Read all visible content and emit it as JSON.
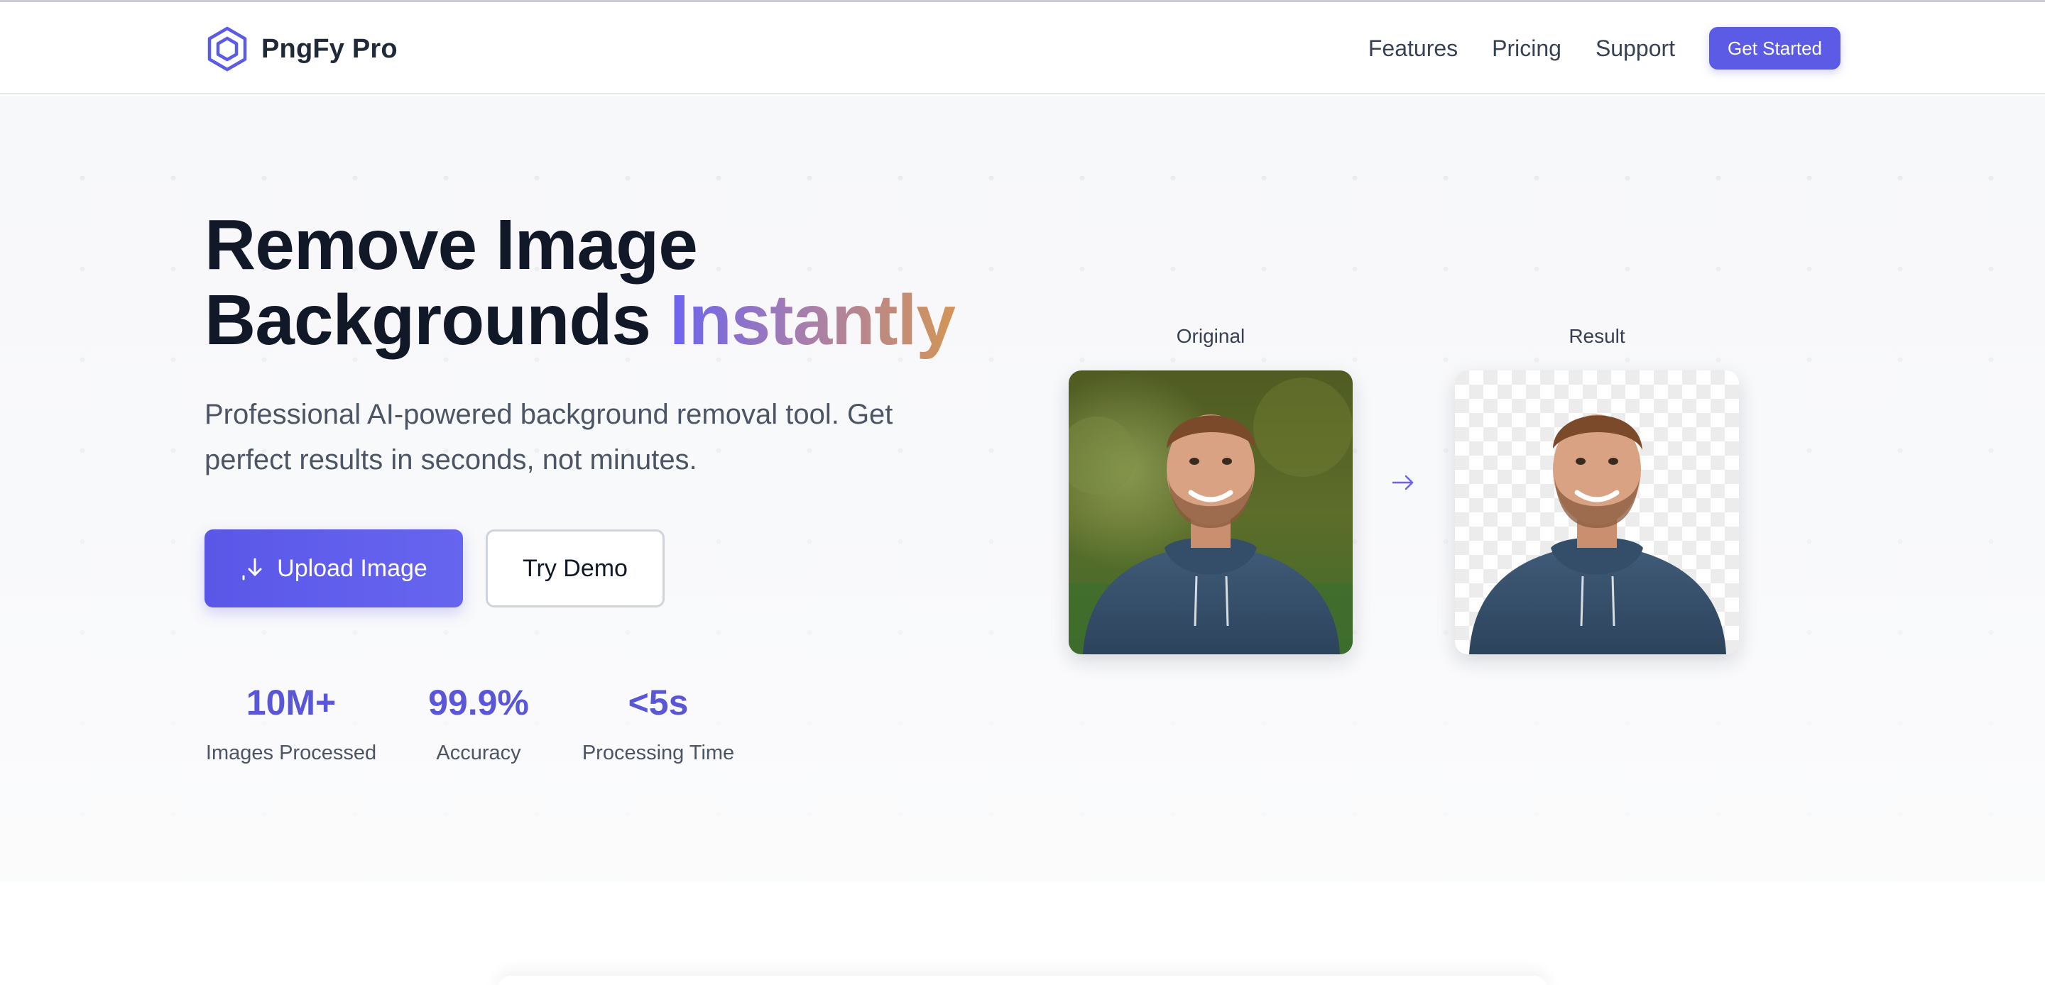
{
  "nav": {
    "brand": "PngFy Pro",
    "links": [
      "Features",
      "Pricing",
      "Support"
    ],
    "cta": "Get Started"
  },
  "hero": {
    "headline_line1": "Remove Image",
    "headline_line2": "Backgrounds",
    "headline_accent": "Instantly",
    "subtext": "Professional AI-powered background removal tool. Get perfect results in seconds, not minutes.",
    "primary_button": "Upload Image",
    "secondary_button": "Try Demo",
    "stats": [
      {
        "value": "10M+",
        "label": "Images Processed"
      },
      {
        "value": "99.9%",
        "label": "Accuracy"
      },
      {
        "value": "<5s",
        "label": "Processing Time"
      }
    ]
  },
  "comparison": {
    "original_label": "Original",
    "result_label": "Result"
  },
  "icons": {
    "logo": "hexagon-logo-icon",
    "upload": "download-arrow-icon",
    "compare": "arrow-right-icon"
  },
  "colors": {
    "accent": "#5b5be6",
    "stat_value": "#5a56d8",
    "headline": "#111827",
    "gradient_start": "#6c63f0",
    "gradient_end": "#d39557"
  }
}
